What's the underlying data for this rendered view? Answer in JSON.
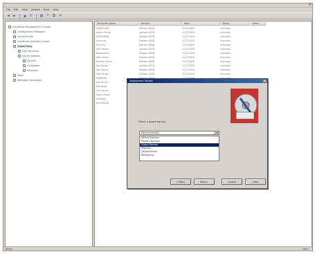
{
  "window": {
    "menus": [
      "File",
      "Edit",
      "View",
      "Actions",
      "Tools",
      "Help"
    ],
    "toolbar_icons": [
      "back-icon",
      "forward-icon",
      "up-icon",
      "refresh-icon",
      "properties-icon",
      "help-icon",
      "copy-icon",
      "delete-icon"
    ]
  },
  "tree": [
    {
      "label": "Enterprise Management Console",
      "level": 0
    },
    {
      "label": "Configuration Database",
      "level": 1
    },
    {
      "label": "Server Profile",
      "level": 1
    },
    {
      "label": "Certificate Authority Server",
      "level": 1
    },
    {
      "label": "Global Policy",
      "level": 1,
      "selected": true
    },
    {
      "label": "User Accounts",
      "level": 2
    },
    {
      "label": "Server Settings",
      "level": 2
    },
    {
      "label": "Servers",
      "level": 3
    },
    {
      "label": "Computers",
      "level": 3
    },
    {
      "label": "Networks",
      "level": 3
    },
    {
      "label": "Tasks",
      "level": 1
    },
    {
      "label": "Managed Computers",
      "level": 1
    }
  ],
  "table": {
    "headers": [
      "Computer Name",
      "Domain",
      "Date",
      "Status",
      "Action"
    ],
    "rows": [
      [
        "SVRADMIN1",
        "Domain NETA\\",
        "12/17/2000",
        "Unlocked"
      ],
      [
        "Admin Server",
        "Domain NETA\\",
        "12/17/2000",
        "Unlocked"
      ],
      [
        "SVRADMIN2",
        "Domain NETA\\",
        "12/17/2000",
        "Unlocked"
      ],
      [
        "Accounts",
        "Domain NETA\\",
        "12/17/2000",
        "Unlocked"
      ],
      [
        "Print Svc",
        "Domain NETA\\",
        "12/17/2000",
        "Unlocked"
      ],
      [
        "Mail Server",
        "Domain NETA\\",
        "12/17/2000",
        "Unlocked"
      ],
      [
        "Workstation",
        "Domain NETA\\",
        "12/17/2000",
        "Unlocked"
      ],
      [
        "Web Server",
        "Domain NETA\\",
        "12/17/2000",
        "Unlocked"
      ],
      [
        "Backup Server",
        "Domain NETA\\",
        "12/17/2000",
        "Unlocked"
      ],
      [
        "File Server",
        "Domain NETA\\",
        "12/17/2000",
        "Unlocked"
      ],
      [
        "Dev Server",
        "Domain NETA\\",
        "12/17/2000",
        "Unlocked"
      ],
      [
        "Test Server",
        "Domain NETA\\",
        "12/17/2000",
        "Unlocked"
      ],
      [
        "SVRBACK",
        "Domain NETA\\",
        "12/17/2000",
        "Unlocked"
      ],
      [
        "Fax Server",
        "",
        "",
        ""
      ],
      [
        "Database",
        "",
        "",
        ""
      ],
      [
        "SQL Server",
        "",
        "",
        ""
      ],
      [
        "Proxy Server",
        "",
        "",
        ""
      ],
      [
        "Gateway",
        "",
        "",
        ""
      ],
      [
        "Host Server",
        "",
        "",
        ""
      ]
    ]
  },
  "dialog": {
    "title": "Deployment Wizard",
    "close": "×",
    "prompt": "Select a target domain:",
    "combo_value": "Default Domain",
    "options": [
      "Default Domain",
      "Primary Domain",
      "Global Domain",
      "Regional",
      "Departmental",
      "Workgroup"
    ],
    "selected_option": 2,
    "buttons": [
      "< Back",
      "Next >",
      "Cancel",
      "Help"
    ]
  },
  "status": {
    "left": "Ready",
    "right": "NUM"
  }
}
